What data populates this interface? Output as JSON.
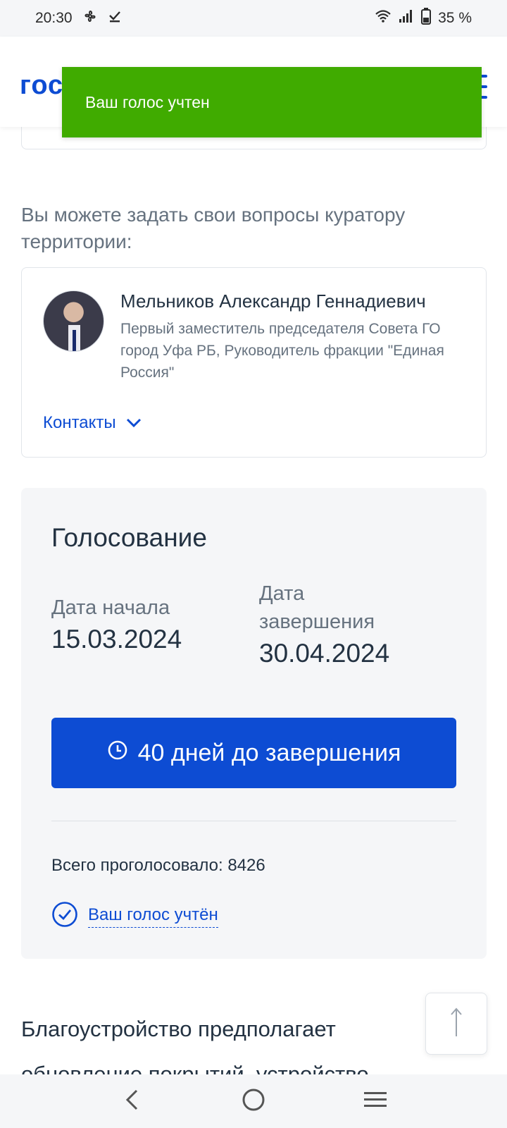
{
  "status_bar": {
    "time": "20:30",
    "battery": "35 %"
  },
  "header": {
    "logo_text": "гос"
  },
  "toast": {
    "message": "Ваш голос учтен"
  },
  "curator": {
    "intro": "Вы можете задать свои вопросы куратору территории:",
    "name": "Мельников Александр Геннадиевич",
    "role": "Первый заместитель председателя Совета ГО город Уфа РБ, Руководитель фракции \"Единая Россия\"",
    "contacts_label": "Контакты"
  },
  "voting": {
    "title": "Голосование",
    "start_label": "Дата начала",
    "start_date": "15.03.2024",
    "end_label": "Дата завершения",
    "end_date": "30.04.2024",
    "countdown": "40 дней до завершения",
    "total_votes": "Всего проголосовало: 8426",
    "voted_status": "Ваш голос учтён"
  },
  "description": {
    "text": "Благоустройство предполагает обновление покрытий, устройство"
  },
  "colors": {
    "primary": "#0d4cd3",
    "success": "#40ab00",
    "text": "#233242",
    "muted": "#66727f",
    "panel": "#f5f6f8"
  }
}
